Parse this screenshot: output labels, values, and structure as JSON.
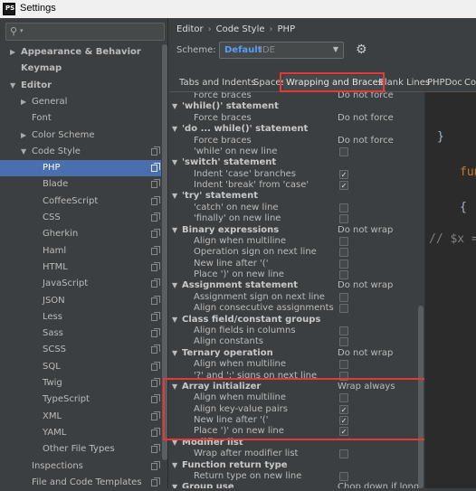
{
  "window": {
    "title": "Settings",
    "app_icon_label": "PS"
  },
  "search": {
    "placeholder": ""
  },
  "tree": [
    {
      "label": "Appearance & Behavior",
      "level": 0,
      "arrow": "▶",
      "bold": true
    },
    {
      "label": "Keymap",
      "level": 0,
      "arrow": "",
      "bold": true
    },
    {
      "label": "Editor",
      "level": 0,
      "arrow": "▼",
      "bold": true
    },
    {
      "label": "General",
      "level": 1,
      "arrow": "▶"
    },
    {
      "label": "Font",
      "level": 1,
      "arrow": ""
    },
    {
      "label": "Color Scheme",
      "level": 1,
      "arrow": "▶"
    },
    {
      "label": "Code Style",
      "level": 1,
      "arrow": "▼",
      "copy": true
    },
    {
      "label": "PHP",
      "level": 2,
      "copy": true,
      "selected": true
    },
    {
      "label": "Blade",
      "level": 2,
      "copy": true
    },
    {
      "label": "CoffeeScript",
      "level": 2,
      "copy": true
    },
    {
      "label": "CSS",
      "level": 2,
      "copy": true
    },
    {
      "label": "Gherkin",
      "level": 2,
      "copy": true
    },
    {
      "label": "Haml",
      "level": 2,
      "copy": true
    },
    {
      "label": "HTML",
      "level": 2,
      "copy": true
    },
    {
      "label": "JavaScript",
      "level": 2,
      "copy": true
    },
    {
      "label": "JSON",
      "level": 2,
      "copy": true
    },
    {
      "label": "Less",
      "level": 2,
      "copy": true
    },
    {
      "label": "Sass",
      "level": 2,
      "copy": true
    },
    {
      "label": "SCSS",
      "level": 2,
      "copy": true
    },
    {
      "label": "SQL",
      "level": 2,
      "copy": true
    },
    {
      "label": "Twig",
      "level": 2,
      "copy": true
    },
    {
      "label": "TypeScript",
      "level": 2,
      "copy": true
    },
    {
      "label": "XML",
      "level": 2,
      "copy": true
    },
    {
      "label": "YAML",
      "level": 2,
      "copy": true
    },
    {
      "label": "Other File Types",
      "level": 2,
      "copy": true
    },
    {
      "label": "Inspections",
      "level": 1,
      "arrow": "",
      "copy": true
    },
    {
      "label": "File and Code Templates",
      "level": 1,
      "arrow": "",
      "copy": true
    }
  ],
  "breadcrumb": {
    "a": "Editor",
    "sep": "›",
    "b": "Code Style",
    "c": "PHP"
  },
  "scheme": {
    "label": "Scheme:",
    "value": "Default",
    "suffix": "IDE"
  },
  "tabs": [
    {
      "label": "Tabs and Indents"
    },
    {
      "label": "Spaces"
    },
    {
      "label": "Wrapping and Braces",
      "active": true
    },
    {
      "label": "Blank Lines"
    },
    {
      "label": "PHPDoc"
    },
    {
      "label": "Co"
    }
  ],
  "rows": [
    {
      "type": "opt",
      "name": "Force braces",
      "value": "Do not force"
    },
    {
      "type": "sec",
      "name": "'while()' statement"
    },
    {
      "type": "opt",
      "name": "Force braces",
      "value": "Do not force"
    },
    {
      "type": "sec",
      "name": "'do ... while()' statement"
    },
    {
      "type": "opt",
      "name": "Force braces",
      "value": "Do not force"
    },
    {
      "type": "opt",
      "name": "'while' on new line",
      "checked": false
    },
    {
      "type": "sec",
      "name": "'switch' statement"
    },
    {
      "type": "opt",
      "name": "Indent 'case' branches",
      "checked": true
    },
    {
      "type": "opt",
      "name": "Indent 'break' from 'case'",
      "checked": true
    },
    {
      "type": "sec",
      "name": "'try' statement"
    },
    {
      "type": "opt",
      "name": "'catch' on new line",
      "checked": false
    },
    {
      "type": "opt",
      "name": "'finally' on new line",
      "checked": false
    },
    {
      "type": "sec",
      "name": "Binary expressions",
      "value": "Do not wrap"
    },
    {
      "type": "opt",
      "name": "Align when multiline",
      "checked": false
    },
    {
      "type": "opt",
      "name": "Operation sign on next line",
      "checked": false
    },
    {
      "type": "opt",
      "name": "New line after '('",
      "checked": false
    },
    {
      "type": "opt",
      "name": "Place ')' on new line",
      "checked": false
    },
    {
      "type": "sec",
      "name": "Assignment statement",
      "value": "Do not wrap"
    },
    {
      "type": "opt",
      "name": "Assignment sign on next line",
      "checked": false
    },
    {
      "type": "opt",
      "name": "Align consecutive assignments",
      "checked": false
    },
    {
      "type": "sec",
      "name": "Class field/constant groups"
    },
    {
      "type": "opt",
      "name": "Align fields in columns",
      "checked": false
    },
    {
      "type": "opt",
      "name": "Align constants",
      "checked": false
    },
    {
      "type": "sec",
      "name": "Ternary operation",
      "value": "Do not wrap"
    },
    {
      "type": "opt",
      "name": "Align when multiline",
      "checked": false
    },
    {
      "type": "opt",
      "name": "'?' and ':' signs on next line",
      "checked": false
    },
    {
      "type": "sec",
      "name": "Array initializer",
      "value": "Wrap always"
    },
    {
      "type": "opt",
      "name": "Align when multiline",
      "checked": false
    },
    {
      "type": "opt",
      "name": "Align key-value pairs",
      "checked": true
    },
    {
      "type": "opt",
      "name": "New line after '('",
      "checked": true
    },
    {
      "type": "opt",
      "name": "Place ')' on new line",
      "checked": true
    },
    {
      "type": "sec",
      "name": "Modifier list"
    },
    {
      "type": "opt",
      "name": "Wrap after modifier list",
      "checked": false
    },
    {
      "type": "sec",
      "name": "Function return type"
    },
    {
      "type": "opt",
      "name": "Return type on new line",
      "checked": false
    },
    {
      "type": "sec",
      "name": "Group use",
      "value": "Chop down if long"
    }
  ],
  "preview": [
    {
      "text": "}",
      "color": "#a9b7c6"
    },
    {
      "text": "fun",
      "color": "#cc7832"
    },
    {
      "text": "{",
      "color": "#a9b7c6"
    },
    {
      "text": "// $x =",
      "color": "#808080"
    }
  ],
  "colors": {
    "selection": "#4b6eaf",
    "accent": "#589df6",
    "highlight_box": "#e53935",
    "panel": "#3c3f41",
    "editor_bg": "#2b2b2b"
  }
}
